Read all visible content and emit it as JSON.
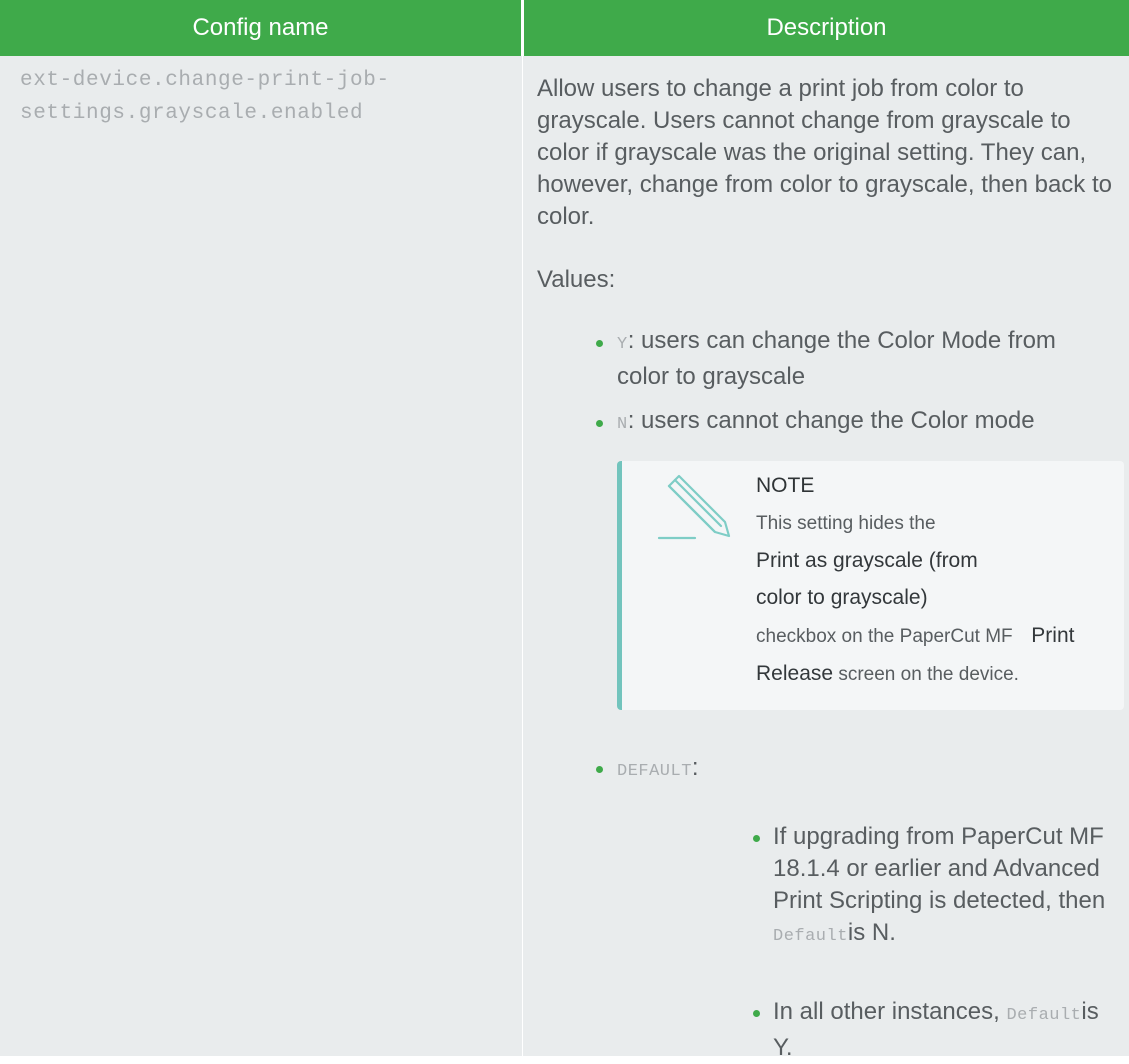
{
  "table": {
    "headers": [
      "Config name",
      "Description"
    ],
    "config_name": "ext-device.change-print-job-settings.grayscale.enabled",
    "config_name_line1": "ext-device.change-print-job-",
    "config_name_line2": "settings.grayscale.enabled",
    "description": "Allow users to change a print job from color to grayscale. Users cannot change from grayscale to color if grayscale was the original setting. They can, however, change from color to grayscale, then back to color.",
    "values_label": "Values:",
    "values": [
      {
        "code": "Y",
        "text": ": users can change the Color Mode from color to grayscale"
      },
      {
        "code": "N",
        "text": ": users cannot change the Color mode"
      },
      {
        "code": "DEFAULT",
        "text": ":"
      }
    ],
    "note": {
      "title": "NOTE",
      "text_1": "This setting hides the",
      "bold_1": "Print as grayscale (from color to grayscale)",
      "text_2": "checkbox on the PaperCut MF",
      "bold_2": "Print Release",
      "text_3": "screen on the device.",
      "icon": "pencil-icon"
    },
    "default_items": [
      {
        "text": "If upgrading from PaperCut MF 18.1.4 or earlier and Advanced Print Scripting is detected, then",
        "code": "Default",
        "tail": "is N."
      },
      {
        "text": "In all other instances,",
        "code": "Default",
        "tail": "is Y."
      }
    ]
  },
  "colors": {
    "header_bg": "#3faa4a",
    "row_bg": "#e9eced",
    "bullet": "#3faa4a",
    "note_border": "#72c4bd"
  }
}
